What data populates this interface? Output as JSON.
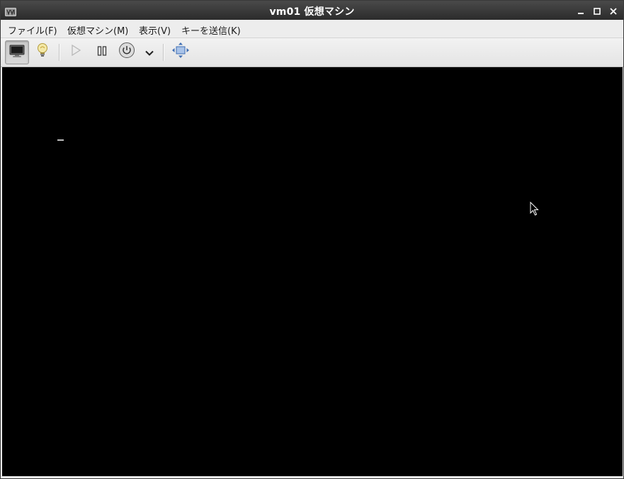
{
  "window": {
    "title": "vm01 仮想マシン",
    "app_icon": "virt-manager-icon",
    "controls": [
      "minimize-icon",
      "maximize-icon",
      "close-icon"
    ]
  },
  "menubar": {
    "items": [
      {
        "label": "ファイル(F)"
      },
      {
        "label": "仮想マシン(M)"
      },
      {
        "label": "表示(V)"
      },
      {
        "label": "キーを送信(K)"
      }
    ]
  },
  "toolbar": {
    "buttons": [
      {
        "icon": "monitor-icon",
        "active": true
      },
      {
        "icon": "lightbulb-icon",
        "active": false
      },
      {
        "icon": "play-icon",
        "enabled": false
      },
      {
        "icon": "pause-icon",
        "enabled": true
      },
      {
        "icon": "power-icon",
        "enabled": true
      },
      {
        "icon": "chevron-down-icon",
        "enabled": true
      },
      {
        "icon": "fullscreen-icon",
        "enabled": true
      }
    ]
  },
  "console": {
    "background": "#000000",
    "text_cursor": "_"
  },
  "colors": {
    "titlebar": "#2b2b2b",
    "toolbar": "#ededed",
    "accent_blue": "#3d6db3"
  }
}
